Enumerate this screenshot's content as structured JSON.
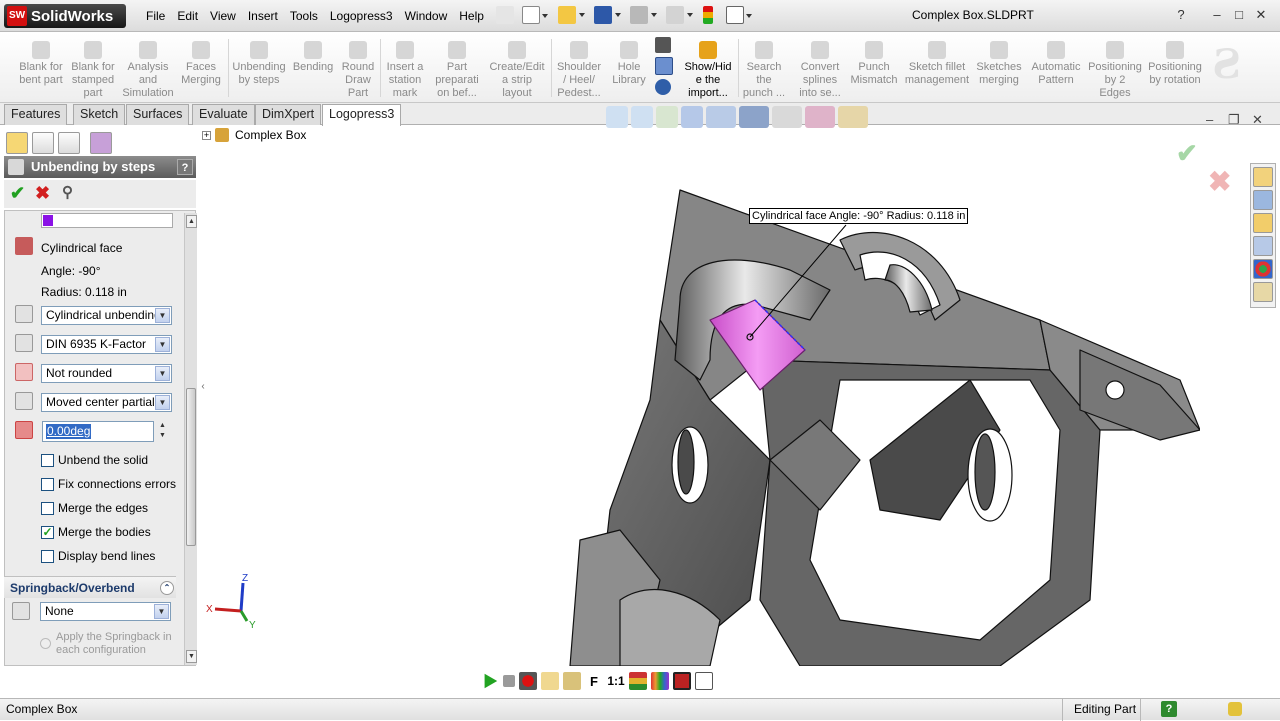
{
  "app": {
    "name": "SolidWorks",
    "logo_badge": "SW",
    "document_title": "Complex Box.SLDPRT"
  },
  "menu": [
    "File",
    "Edit",
    "View",
    "Insert",
    "Tools",
    "Logopress3",
    "Window",
    "Help"
  ],
  "window_controls": {
    "help": "?",
    "minimize": "–",
    "restore": "□",
    "close": "✕"
  },
  "commands": [
    "Blank for bent part",
    "Blank for stamped part",
    "Analysis and Simulation",
    "Faces Merging",
    "Unbending by steps",
    "Bending",
    "Round Draw Part",
    "Insert a station mark",
    "Part preparati on bef...",
    "Create/Edit a strip layout",
    "Shoulder / Heel/ Pedest...",
    "Hole Library",
    "Show/Hid e the import...",
    "Search the punch ...",
    "Convert splines into se...",
    "Punch Mismatch",
    "Sketch fillet management",
    "Sketches merging",
    "Automatic Pattern",
    "Positioning by 2 Edges",
    "Positioning by rotation"
  ],
  "tabs": [
    "Features",
    "Sketch",
    "Surfaces",
    "Evaluate",
    "DimXpert",
    "Logopress3"
  ],
  "active_tab": "Logopress3",
  "property_manager": {
    "title": "Unbending by steps",
    "help": "?",
    "face_name": "Cylindrical face",
    "angle": "Angle: -90°",
    "radius": "Radius: 0.118 in",
    "unbending_type": "Cylindrical unbending",
    "kfactor": "DIN 6935 K-Factor",
    "rounding": "Not rounded",
    "position": "Moved center partial u",
    "angle_value": "0.00deg",
    "options": [
      {
        "label": "Unbend the solid",
        "checked": false
      },
      {
        "label": "Fix connections errors",
        "checked": false
      },
      {
        "label": "Merge the edges",
        "checked": false
      },
      {
        "label": "Merge the bodies",
        "checked": true
      },
      {
        "label": "Display bend lines",
        "checked": false
      }
    ],
    "springback": {
      "title": "Springback/Overbend",
      "mode": "None",
      "apply_label_1": "Apply the Springback in",
      "apply_label_2": "each configuration"
    }
  },
  "tree": {
    "root": "Complex Box",
    "expand": "+"
  },
  "callout": "Cylindrical face Angle: -90° Radius: 0.118 in",
  "triad": {
    "x": "X",
    "y": "Y",
    "z": "Z"
  },
  "bottombar": {
    "fast": "F",
    "ratio": "1:1"
  },
  "status": {
    "left": "Complex Box",
    "mode": "Editing Part",
    "help": "?"
  },
  "colors": {
    "highlight": "#e472e4",
    "selection": "#316ac5",
    "accept": "#21a121",
    "cancel": "#d21f1f"
  }
}
